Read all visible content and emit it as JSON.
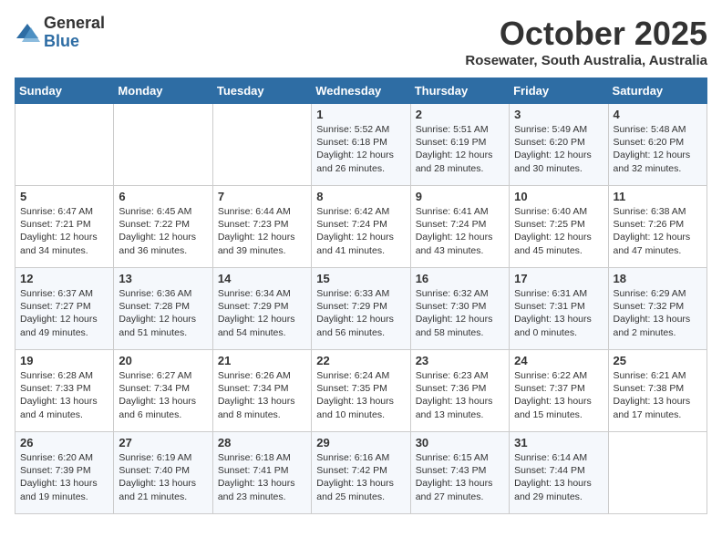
{
  "logo": {
    "general": "General",
    "blue": "Blue"
  },
  "title": "October 2025",
  "location": "Rosewater, South Australia, Australia",
  "days_of_week": [
    "Sunday",
    "Monday",
    "Tuesday",
    "Wednesday",
    "Thursday",
    "Friday",
    "Saturday"
  ],
  "weeks": [
    [
      {
        "day": "",
        "info": ""
      },
      {
        "day": "",
        "info": ""
      },
      {
        "day": "",
        "info": ""
      },
      {
        "day": "1",
        "info": "Sunrise: 5:52 AM\nSunset: 6:18 PM\nDaylight: 12 hours\nand 26 minutes."
      },
      {
        "day": "2",
        "info": "Sunrise: 5:51 AM\nSunset: 6:19 PM\nDaylight: 12 hours\nand 28 minutes."
      },
      {
        "day": "3",
        "info": "Sunrise: 5:49 AM\nSunset: 6:20 PM\nDaylight: 12 hours\nand 30 minutes."
      },
      {
        "day": "4",
        "info": "Sunrise: 5:48 AM\nSunset: 6:20 PM\nDaylight: 12 hours\nand 32 minutes."
      }
    ],
    [
      {
        "day": "5",
        "info": "Sunrise: 6:47 AM\nSunset: 7:21 PM\nDaylight: 12 hours\nand 34 minutes."
      },
      {
        "day": "6",
        "info": "Sunrise: 6:45 AM\nSunset: 7:22 PM\nDaylight: 12 hours\nand 36 minutes."
      },
      {
        "day": "7",
        "info": "Sunrise: 6:44 AM\nSunset: 7:23 PM\nDaylight: 12 hours\nand 39 minutes."
      },
      {
        "day": "8",
        "info": "Sunrise: 6:42 AM\nSunset: 7:24 PM\nDaylight: 12 hours\nand 41 minutes."
      },
      {
        "day": "9",
        "info": "Sunrise: 6:41 AM\nSunset: 7:24 PM\nDaylight: 12 hours\nand 43 minutes."
      },
      {
        "day": "10",
        "info": "Sunrise: 6:40 AM\nSunset: 7:25 PM\nDaylight: 12 hours\nand 45 minutes."
      },
      {
        "day": "11",
        "info": "Sunrise: 6:38 AM\nSunset: 7:26 PM\nDaylight: 12 hours\nand 47 minutes."
      }
    ],
    [
      {
        "day": "12",
        "info": "Sunrise: 6:37 AM\nSunset: 7:27 PM\nDaylight: 12 hours\nand 49 minutes."
      },
      {
        "day": "13",
        "info": "Sunrise: 6:36 AM\nSunset: 7:28 PM\nDaylight: 12 hours\nand 51 minutes."
      },
      {
        "day": "14",
        "info": "Sunrise: 6:34 AM\nSunset: 7:29 PM\nDaylight: 12 hours\nand 54 minutes."
      },
      {
        "day": "15",
        "info": "Sunrise: 6:33 AM\nSunset: 7:29 PM\nDaylight: 12 hours\nand 56 minutes."
      },
      {
        "day": "16",
        "info": "Sunrise: 6:32 AM\nSunset: 7:30 PM\nDaylight: 12 hours\nand 58 minutes."
      },
      {
        "day": "17",
        "info": "Sunrise: 6:31 AM\nSunset: 7:31 PM\nDaylight: 13 hours\nand 0 minutes."
      },
      {
        "day": "18",
        "info": "Sunrise: 6:29 AM\nSunset: 7:32 PM\nDaylight: 13 hours\nand 2 minutes."
      }
    ],
    [
      {
        "day": "19",
        "info": "Sunrise: 6:28 AM\nSunset: 7:33 PM\nDaylight: 13 hours\nand 4 minutes."
      },
      {
        "day": "20",
        "info": "Sunrise: 6:27 AM\nSunset: 7:34 PM\nDaylight: 13 hours\nand 6 minutes."
      },
      {
        "day": "21",
        "info": "Sunrise: 6:26 AM\nSunset: 7:34 PM\nDaylight: 13 hours\nand 8 minutes."
      },
      {
        "day": "22",
        "info": "Sunrise: 6:24 AM\nSunset: 7:35 PM\nDaylight: 13 hours\nand 10 minutes."
      },
      {
        "day": "23",
        "info": "Sunrise: 6:23 AM\nSunset: 7:36 PM\nDaylight: 13 hours\nand 13 minutes."
      },
      {
        "day": "24",
        "info": "Sunrise: 6:22 AM\nSunset: 7:37 PM\nDaylight: 13 hours\nand 15 minutes."
      },
      {
        "day": "25",
        "info": "Sunrise: 6:21 AM\nSunset: 7:38 PM\nDaylight: 13 hours\nand 17 minutes."
      }
    ],
    [
      {
        "day": "26",
        "info": "Sunrise: 6:20 AM\nSunset: 7:39 PM\nDaylight: 13 hours\nand 19 minutes."
      },
      {
        "day": "27",
        "info": "Sunrise: 6:19 AM\nSunset: 7:40 PM\nDaylight: 13 hours\nand 21 minutes."
      },
      {
        "day": "28",
        "info": "Sunrise: 6:18 AM\nSunset: 7:41 PM\nDaylight: 13 hours\nand 23 minutes."
      },
      {
        "day": "29",
        "info": "Sunrise: 6:16 AM\nSunset: 7:42 PM\nDaylight: 13 hours\nand 25 minutes."
      },
      {
        "day": "30",
        "info": "Sunrise: 6:15 AM\nSunset: 7:43 PM\nDaylight: 13 hours\nand 27 minutes."
      },
      {
        "day": "31",
        "info": "Sunrise: 6:14 AM\nSunset: 7:44 PM\nDaylight: 13 hours\nand 29 minutes."
      },
      {
        "day": "",
        "info": ""
      }
    ]
  ]
}
